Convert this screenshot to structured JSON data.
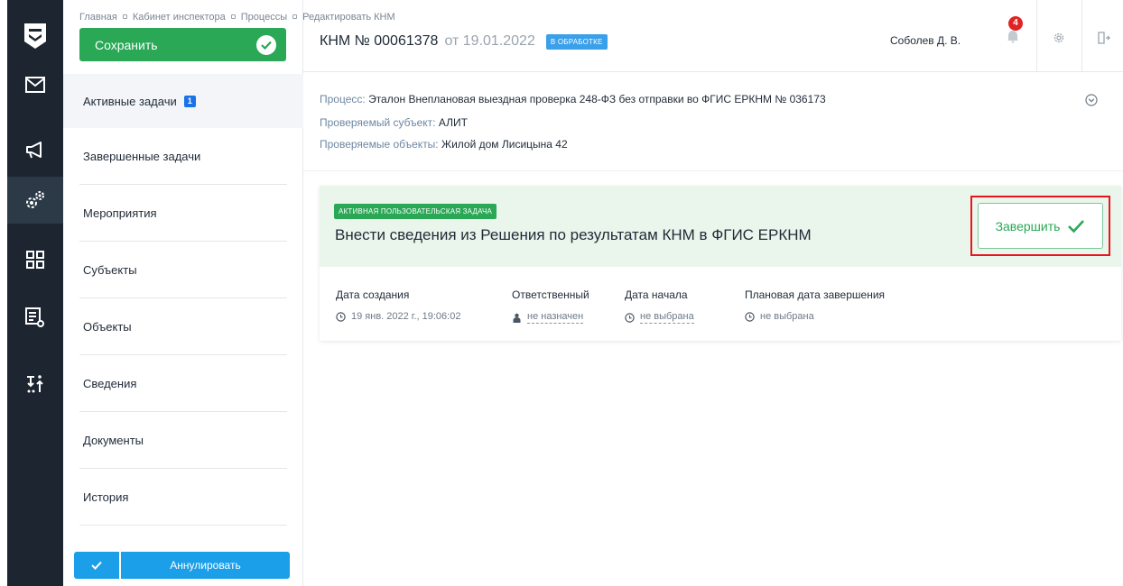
{
  "rail": {
    "items": [
      {
        "icon": "mail-icon"
      },
      {
        "icon": "megaphone-icon"
      },
      {
        "icon": "gears-icon",
        "active": true
      },
      {
        "icon": "dashboard-icon"
      },
      {
        "icon": "report-search-icon"
      },
      {
        "icon": "sort-transfer-icon"
      }
    ]
  },
  "sidebar": {
    "save_label": "Сохранить",
    "items": [
      {
        "label": "Активные задачи",
        "badge": "1"
      },
      {
        "label": "Завершенные задачи"
      },
      {
        "label": "Мероприятия"
      },
      {
        "label": "Субъекты"
      },
      {
        "label": "Объекты"
      },
      {
        "label": "Сведения"
      },
      {
        "label": "Документы"
      },
      {
        "label": "История"
      }
    ],
    "annul_label": "Аннулировать"
  },
  "header": {
    "breadcrumb": [
      "Главная",
      "Кабинет инспектора",
      "Процессы",
      "Редактировать КНМ"
    ],
    "title_number": "КНМ № 00061378",
    "title_date": "от 19.01.2022",
    "status": "В ОБРАБОТКЕ",
    "user": "Соболев Д. В.",
    "notifications": "4"
  },
  "process": {
    "process_key": "Процесс:",
    "process_value": "Эталон Внеплановая выездная проверка 248-ФЗ без отправки во ФГИС ЕРКНМ № 036173",
    "subject_key": "Проверяемый субъект:",
    "subject_value": "АЛИТ",
    "objects_key": "Проверяемые объекты:",
    "objects_value": "Жилой дом Лисицына 42"
  },
  "task": {
    "badge": "АКТИВНАЯ ПОЛЬЗОВАТЕЛЬСКАЯ ЗАДАЧА",
    "title": "Внести сведения из Решения по результатам КНМ в ФГИС ЕРКНМ",
    "finish_label": "Завершить",
    "created_label": "Дата создания",
    "created_value": "19 янв. 2022 г., 19:06:02",
    "responsible_label": "Ответственный",
    "responsible_value": "не назначен",
    "start_label": "Дата начала",
    "start_value": "не выбрана",
    "planned_end_label": "Плановая дата завершения",
    "planned_end_value": "не выбрана"
  },
  "colors": {
    "rail_bg": "#1c2530",
    "save_green": "#2aa856",
    "status_blue": "#3aa0ea",
    "annul_blue": "#1a9fe8",
    "task_bg": "#eaf6ec",
    "highlight_red": "#e8151b",
    "badge_red": "#e02424"
  }
}
